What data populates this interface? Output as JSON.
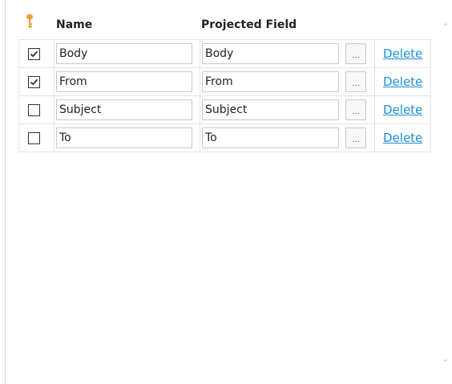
{
  "header": {
    "key_icon": "key-icon",
    "name_label": "Name",
    "projected_label": "Projected Field"
  },
  "rows": [
    {
      "checked": true,
      "name": "Body",
      "projected": "Body",
      "browse_label": "...",
      "delete_label": "Delete"
    },
    {
      "checked": true,
      "name": "From",
      "projected": "From",
      "browse_label": "...",
      "delete_label": "Delete"
    },
    {
      "checked": false,
      "name": "Subject",
      "projected": "Subject",
      "browse_label": "...",
      "delete_label": "Delete"
    },
    {
      "checked": false,
      "name": "To",
      "projected": "To",
      "browse_label": "...",
      "delete_label": "Delete"
    }
  ],
  "colors": {
    "link": "#1a8fd8",
    "key": "#e8a33a"
  }
}
